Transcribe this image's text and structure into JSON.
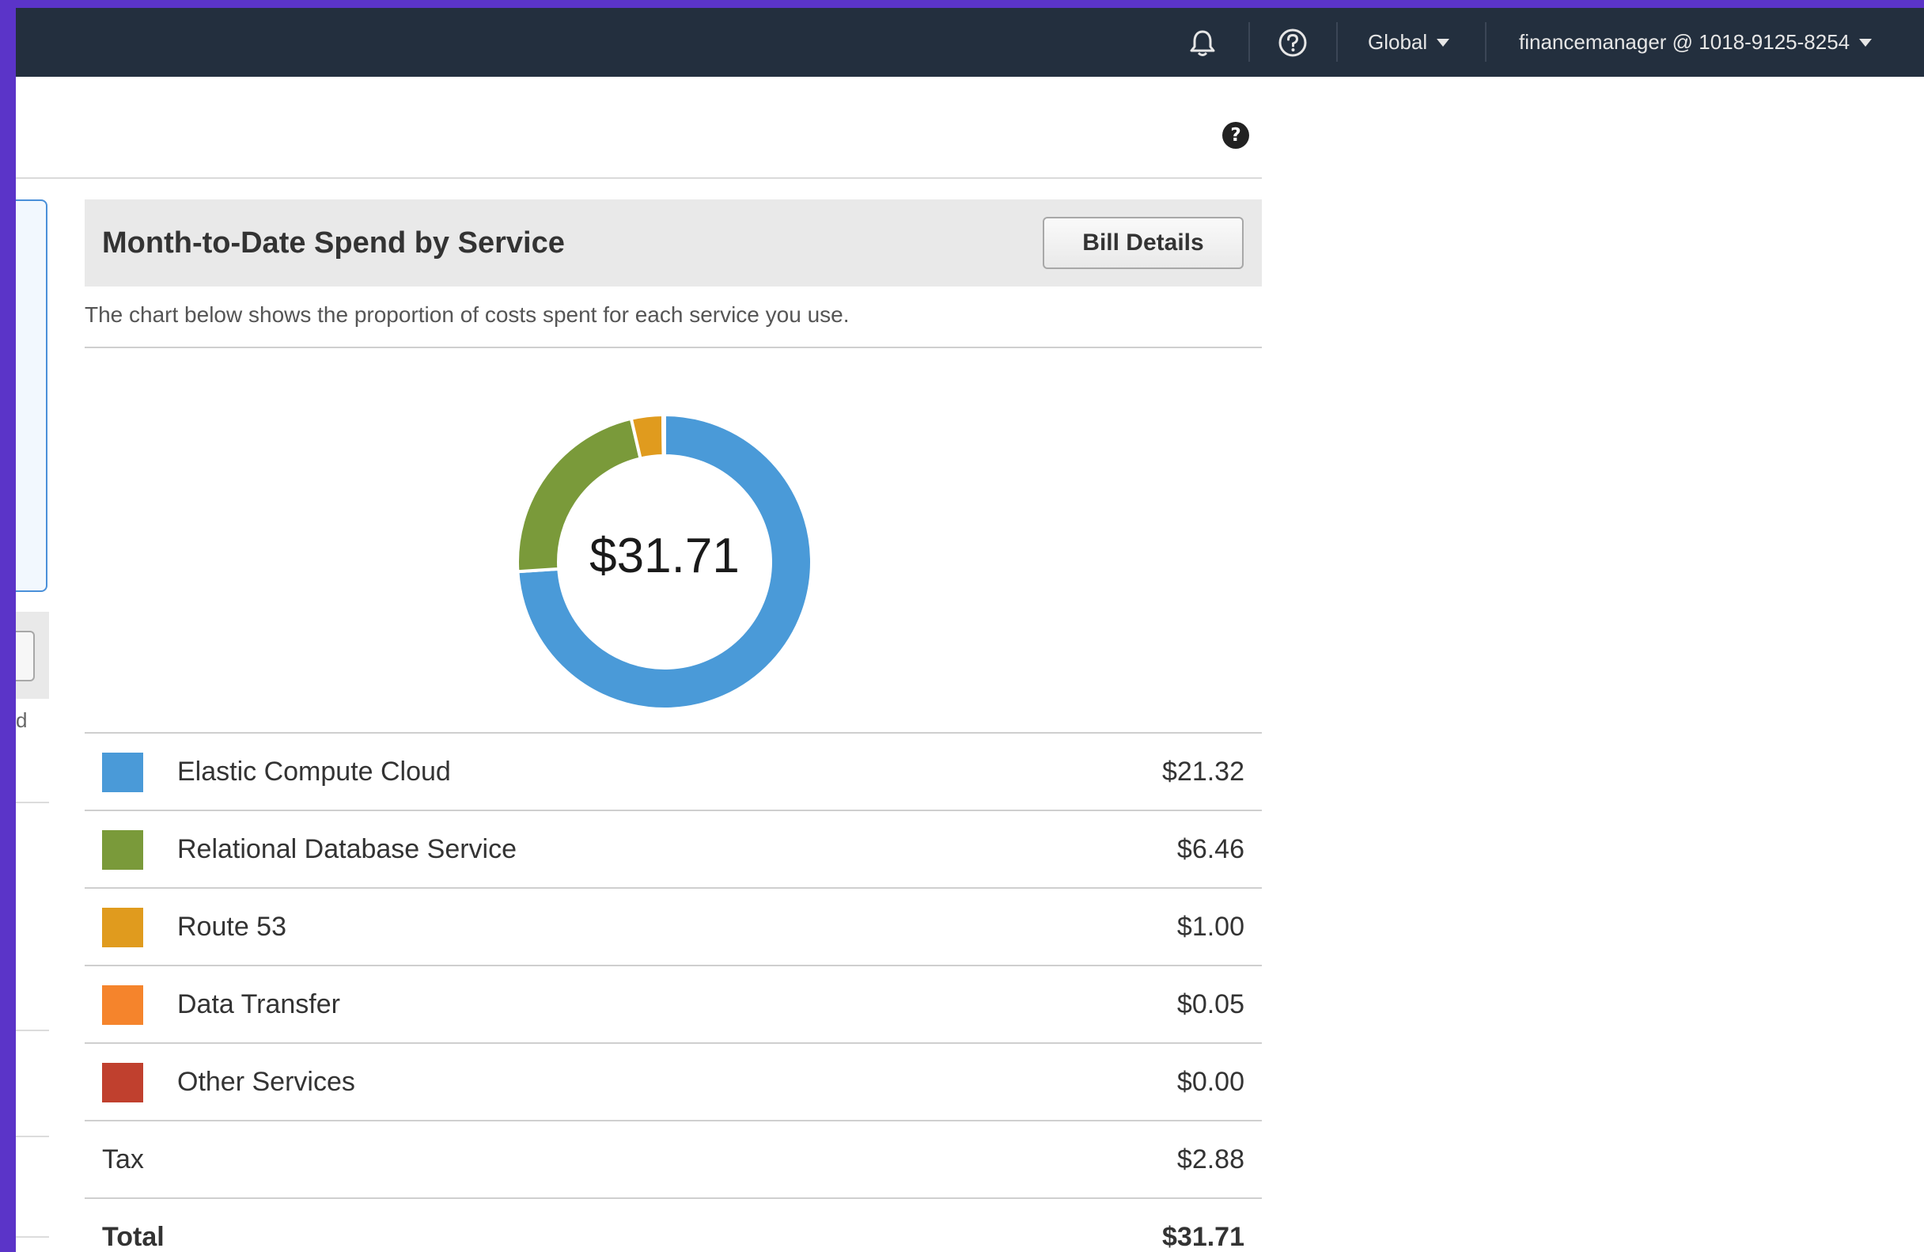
{
  "topnav": {
    "region": "Global",
    "account": "financemanager @ 1018-9125-8254"
  },
  "left_panel": {
    "fragment": "d"
  },
  "widget": {
    "title": "Month-to-Date Spend by Service",
    "bill_details_button": "Bill Details",
    "description": "The chart below shows the proportion of costs spent for each service you use.",
    "center_total": "$31.71"
  },
  "services": [
    {
      "name": "Elastic Compute Cloud",
      "amount": "$21.32",
      "color": "#4a9ad8"
    },
    {
      "name": "Relational Database Service",
      "amount": "$6.46",
      "color": "#7a9a3a"
    },
    {
      "name": "Route 53",
      "amount": "$1.00",
      "color": "#e09b1e"
    },
    {
      "name": "Data Transfer",
      "amount": "$0.05",
      "color": "#f5842c"
    },
    {
      "name": "Other Services",
      "amount": "$0.00",
      "color": "#c0402e"
    }
  ],
  "tax": {
    "label": "Tax",
    "amount": "$2.88"
  },
  "total": {
    "label": "Total",
    "amount": "$31.71"
  },
  "chart_data": {
    "type": "pie",
    "categories": [
      "Elastic Compute Cloud",
      "Relational Database Service",
      "Route 53",
      "Data Transfer",
      "Other Services"
    ],
    "values": [
      21.32,
      6.46,
      1.0,
      0.05,
      0.0
    ],
    "colors": [
      "#4a9ad8",
      "#7a9a3a",
      "#e09b1e",
      "#f5842c",
      "#c0402e"
    ],
    "center_label": "$31.71"
  },
  "icons": {
    "bell": "bell-icon",
    "help": "help-circle-icon",
    "page_help": "question-circle-icon"
  }
}
